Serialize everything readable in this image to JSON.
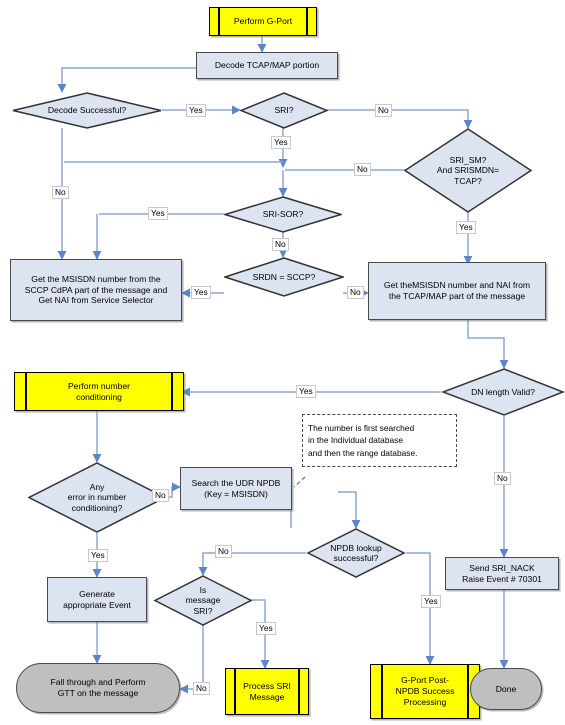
{
  "diagram": {
    "title": "Perform G-Port flowchart",
    "colors": {
      "process_fill": "#dce4f2",
      "predefined_fill": "#ffff00",
      "terminator_fill": "#bfbfbf",
      "connector": "#8ea9d0",
      "border": "#4a4a4a"
    },
    "nodes": [
      {
        "id": "start",
        "type": "predefined-process",
        "label": "Perform G-Port"
      },
      {
        "id": "decode",
        "type": "process",
        "label": "Decode TCAP/MAP portion"
      },
      {
        "id": "decode_ok",
        "type": "decision",
        "label": "Decode Successful?"
      },
      {
        "id": "sri",
        "type": "decision",
        "label": "SRI?"
      },
      {
        "id": "sri_sm",
        "type": "decision",
        "label": "SRI_SM?\nAnd SRISMDN=\nTCAP?"
      },
      {
        "id": "sri_sor",
        "type": "decision",
        "label": "SRI-SOR?"
      },
      {
        "id": "srdn_sccp",
        "type": "decision",
        "label": "SRDN = SCCP?"
      },
      {
        "id": "get_sccp",
        "type": "process",
        "label": "Get the MSISDN number from the SCCP CdPA part of the message and Get NAI from Service Selector"
      },
      {
        "id": "get_tcap",
        "type": "process",
        "label": "Get theMSISDN number and NAI from the TCAP/MAP part of the message"
      },
      {
        "id": "dn_len",
        "type": "decision",
        "label": "DN length Valid?"
      },
      {
        "id": "num_cond",
        "type": "predefined-process",
        "label": "Perform number conditioning"
      },
      {
        "id": "any_error",
        "type": "decision",
        "label": "Any\nerror in number\nconditioning?"
      },
      {
        "id": "search_npdb",
        "type": "process",
        "label": "Search the UDR NPDB (Key = MSISDN)"
      },
      {
        "id": "note",
        "type": "note",
        "label": "The number is first searched in the Individual database and then the range database."
      },
      {
        "id": "npdb_ok",
        "type": "decision",
        "label": "NPDB lookup successful?"
      },
      {
        "id": "is_sri",
        "type": "decision",
        "label": "Is\nmessage\nSRI?"
      },
      {
        "id": "gen_event",
        "type": "process",
        "label": "Generate appropriate Event"
      },
      {
        "id": "send_nack",
        "type": "process",
        "label": "Send SRI_NACK Raise Event # 70301"
      },
      {
        "id": "fallthrough",
        "type": "terminator",
        "label": "Fall through and Perform GTT on the message"
      },
      {
        "id": "process_sri",
        "type": "predefined-process",
        "label": "Process SRI Message"
      },
      {
        "id": "gport_post",
        "type": "predefined-process",
        "label": "G-Port Post-NPDB Success Processing"
      },
      {
        "id": "done",
        "type": "terminator",
        "label": "Done"
      }
    ],
    "node_text": {
      "start": "Perform G-Port",
      "decode": "Decode TCAP/MAP portion",
      "decode_ok": "Decode Successful?",
      "sri": "SRI?",
      "sri_sm_l1": "SRI_SM?",
      "sri_sm_l2": "And SRISMDN=",
      "sri_sm_l3": "TCAP?",
      "sri_sor": "SRI-SOR?",
      "srdn_sccp": "SRDN = SCCP?",
      "get_sccp_l1": "Get the MSISDN number from the",
      "get_sccp_l2": "SCCP CdPA part of the message and",
      "get_sccp_l3": "Get NAI from Service Selector",
      "get_tcap_l1": "Get theMSISDN number and NAI from",
      "get_tcap_l2": "the TCAP/MAP part of the message",
      "dn_len": "DN length Valid?",
      "num_cond_l1": "Perform number",
      "num_cond_l2": "conditioning",
      "any_error_l1": "Any",
      "any_error_l2": "error in number",
      "any_error_l3": "conditioning?",
      "search_npdb_l1": "Search the UDR NPDB",
      "search_npdb_l2": "(Key = MSISDN)",
      "note_l1": "The number is first searched",
      "note_l2": "in the Individual database",
      "note_l3": "and then the range database.",
      "npdb_ok_l1": "NPDB lookup",
      "npdb_ok_l2": "successful?",
      "is_sri_l1": "Is",
      "is_sri_l2": "message",
      "is_sri_l3": "SRI?",
      "gen_event_l1": "Generate",
      "gen_event_l2": "appropriate Event",
      "send_nack_l1": "Send SRI_NACK",
      "send_nack_l2": "Raise Event # 70301",
      "fallthrough_l1": "Fall through and Perform",
      "fallthrough_l2": "GTT on the message",
      "process_sri_l1": "Process SRI",
      "process_sri_l2": "Message",
      "gport_post_l1": "G-Port Post-",
      "gport_post_l2": "NPDB Success",
      "gport_post_l3": "Processing",
      "done": "Done"
    },
    "edge_labels": {
      "decode_ok_yes": "Yes",
      "decode_ok_no": "No",
      "sri_no": "No",
      "sri_yes": "Yes",
      "sri_sm_no": "No",
      "sri_sm_yes": "Yes",
      "sri_sor_yes": "Yes",
      "sri_sor_no": "No",
      "srdn_yes": "Yes",
      "srdn_no": "No",
      "dn_len_yes": "Yes",
      "dn_len_no": "No",
      "any_error_no": "No",
      "any_error_yes": "Yes",
      "npdb_no": "No",
      "npdb_yes": "Yes",
      "is_sri_yes": "Yes",
      "is_sri_no": "No"
    }
  }
}
